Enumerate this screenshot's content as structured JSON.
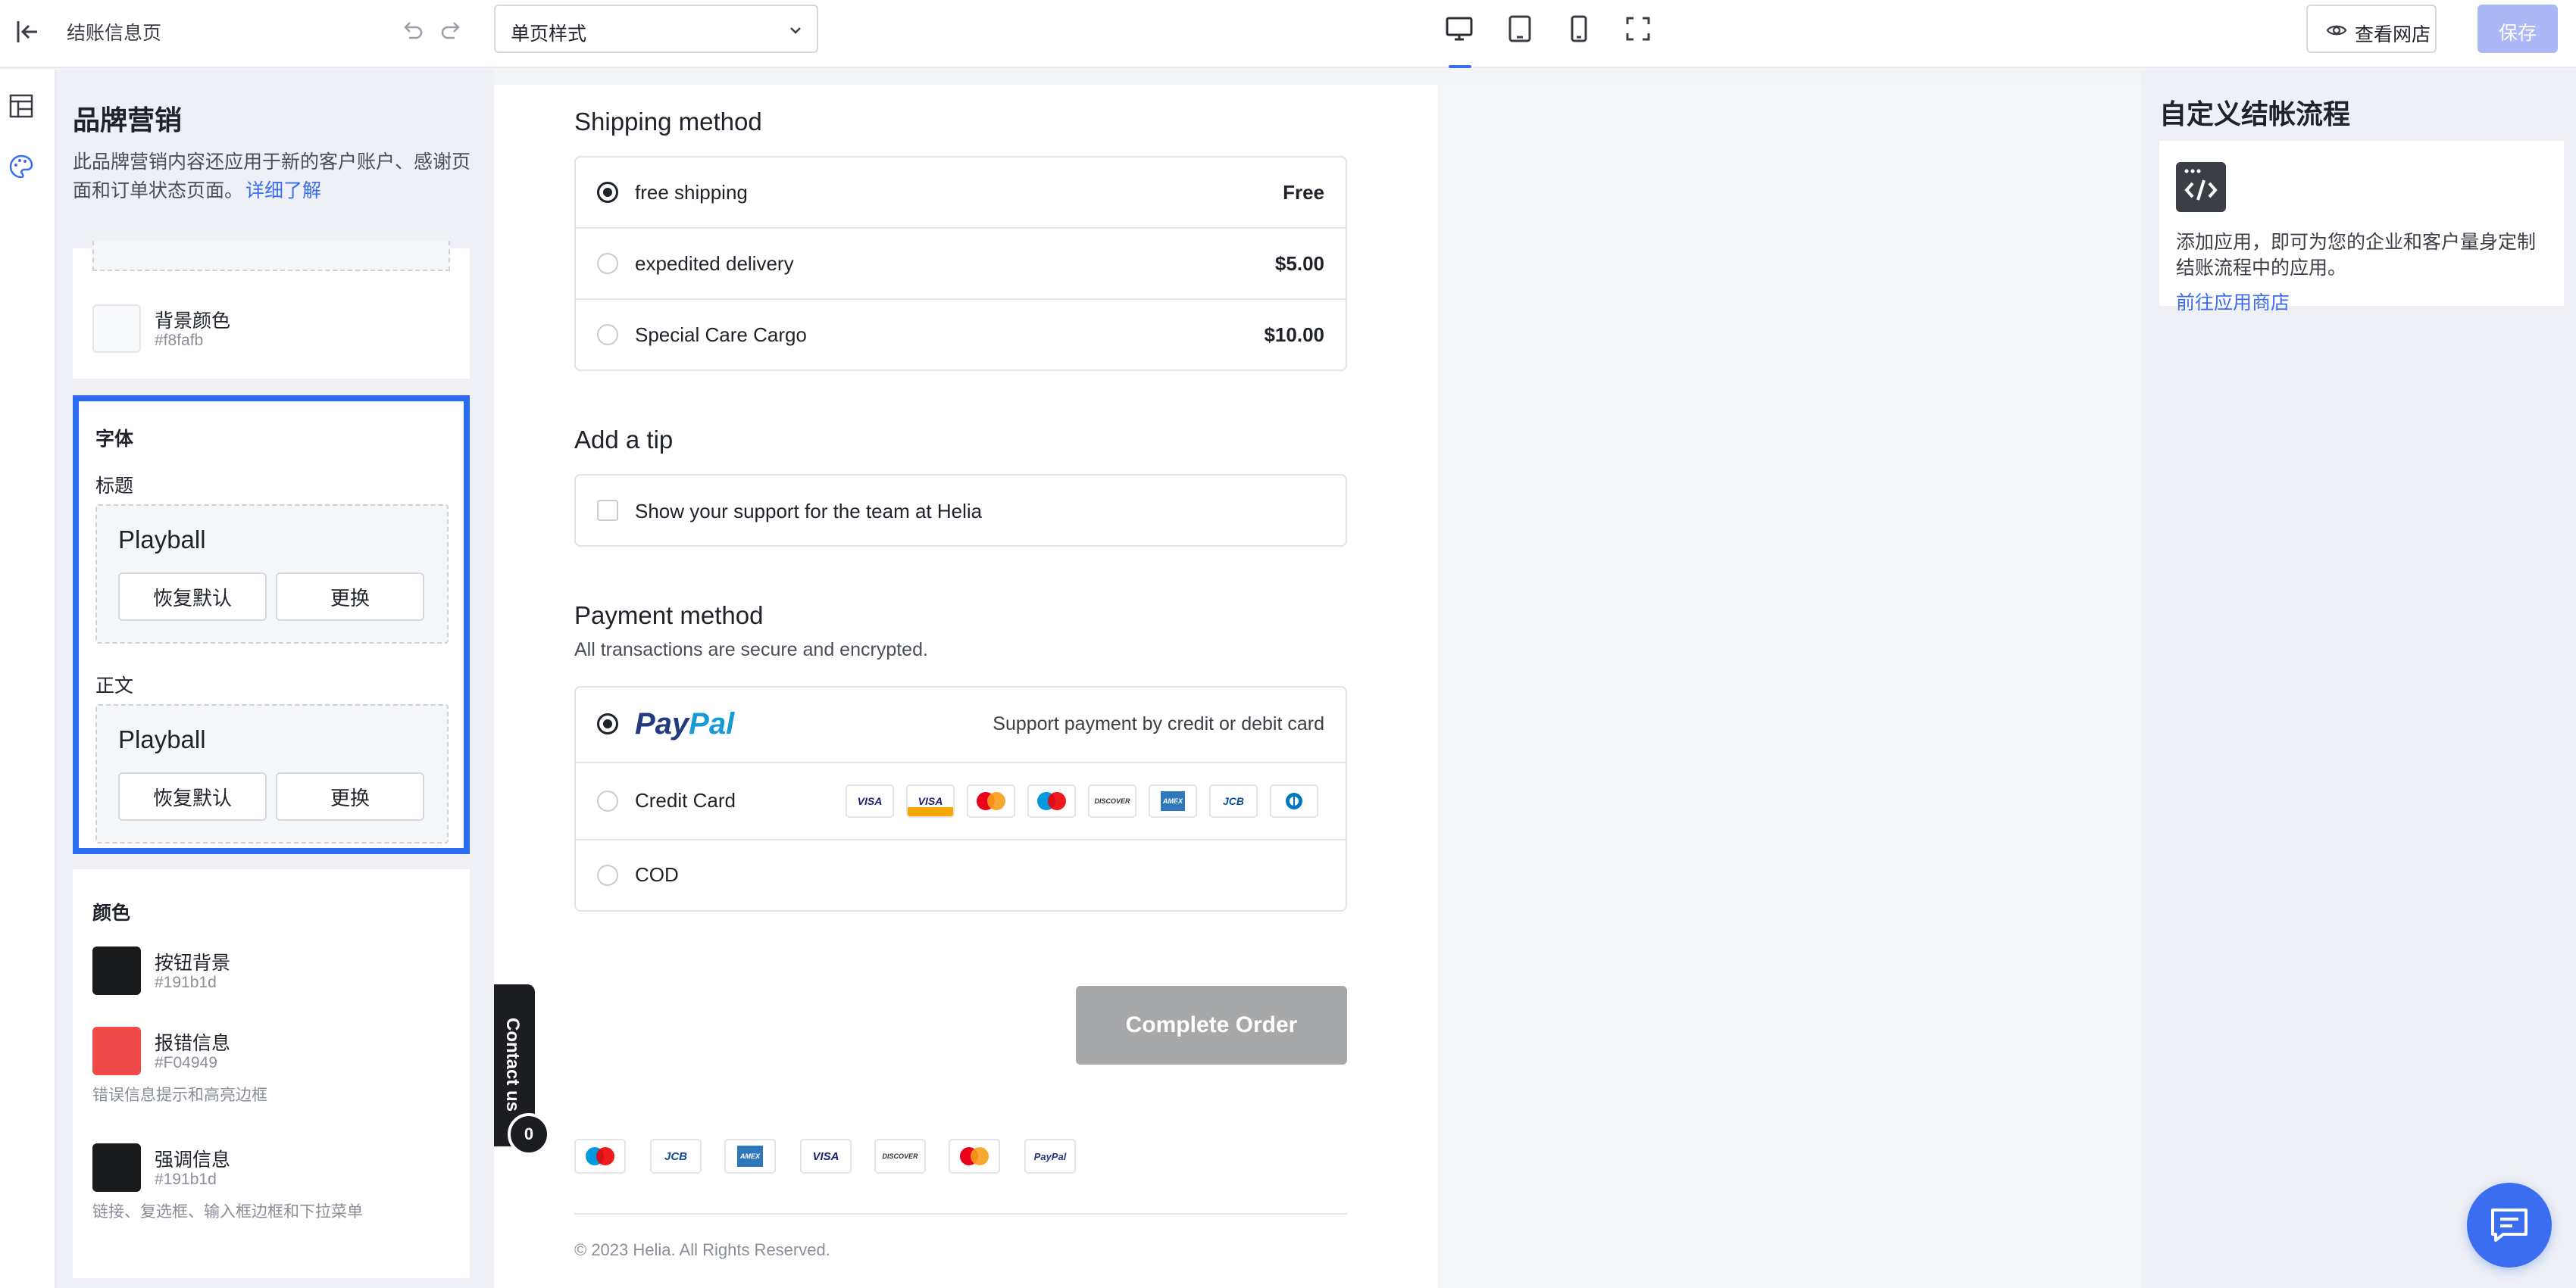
{
  "header": {
    "page_title": "结账信息页",
    "template_select": "单页样式",
    "view_store_label": "查看网店",
    "save_label": "保存"
  },
  "left_panel": {
    "title": "品牌营销",
    "description_line1": "此品牌营销内容还应用于新的客户账户、感谢页",
    "description_line2": "面和订单状态页面。",
    "learn_more": "详细了解",
    "background_color": {
      "label": "背景颜色",
      "value": "#f8fafb"
    },
    "font_section": {
      "title": "字体",
      "heading_label": "标题",
      "heading_font": "Playball",
      "body_label": "正文",
      "body_font": "Playball",
      "reset_label": "恢复默认",
      "change_label": "更换"
    },
    "color_section": {
      "title": "颜色",
      "items": [
        {
          "label": "按钮背景",
          "value": "#191b1d",
          "swatch": "#191b1d",
          "note": ""
        },
        {
          "label": "报错信息",
          "value": "#F04949",
          "swatch": "#F04949",
          "note": "错误信息提示和高亮边框"
        },
        {
          "label": "强调信息",
          "value": "#191b1d",
          "swatch": "#191b1d",
          "note": "链接、复选框、输入框边框和下拉菜单"
        }
      ]
    }
  },
  "checkout": {
    "shipping_title": "Shipping method",
    "shipping_options": [
      {
        "name": "free shipping",
        "price": "Free",
        "selected": true
      },
      {
        "name": "expedited delivery",
        "price": "$5.00",
        "selected": false
      },
      {
        "name": "Special Care Cargo",
        "price": "$10.00",
        "selected": false
      }
    ],
    "tip_title": "Add a tip",
    "tip_checkbox": "Show your support for the team at Helia",
    "payment_title": "Payment method",
    "payment_subtitle": "All transactions are secure and encrypted.",
    "paypal_logo_pay": "Pay",
    "paypal_logo_pal": "Pal",
    "paypal_note": "Support payment by credit or debit card",
    "credit_card_label": "Credit Card",
    "cod_label": "COD",
    "complete_order": "Complete Order",
    "contact_us": "Contact us",
    "contact_badge": "0",
    "copyright": "© 2023 Helia. All Rights Reserved.",
    "card_logo_text": {
      "visa": "VISA",
      "discover": "DISCOVER",
      "amex": "AMEX",
      "jcb": "JCB",
      "paypal": "PayPal"
    }
  },
  "right_panel": {
    "title": "自定义结帐流程",
    "desc_line1": "添加应用，即可为您的企业和客户量身定制",
    "desc_line2": "结账流程中的应用。",
    "link": "前往应用商店"
  },
  "colors": {
    "accent": "#3a6df0",
    "save_disabled": "#aab8f5",
    "complete_order_bg": "#a7a8aa"
  }
}
